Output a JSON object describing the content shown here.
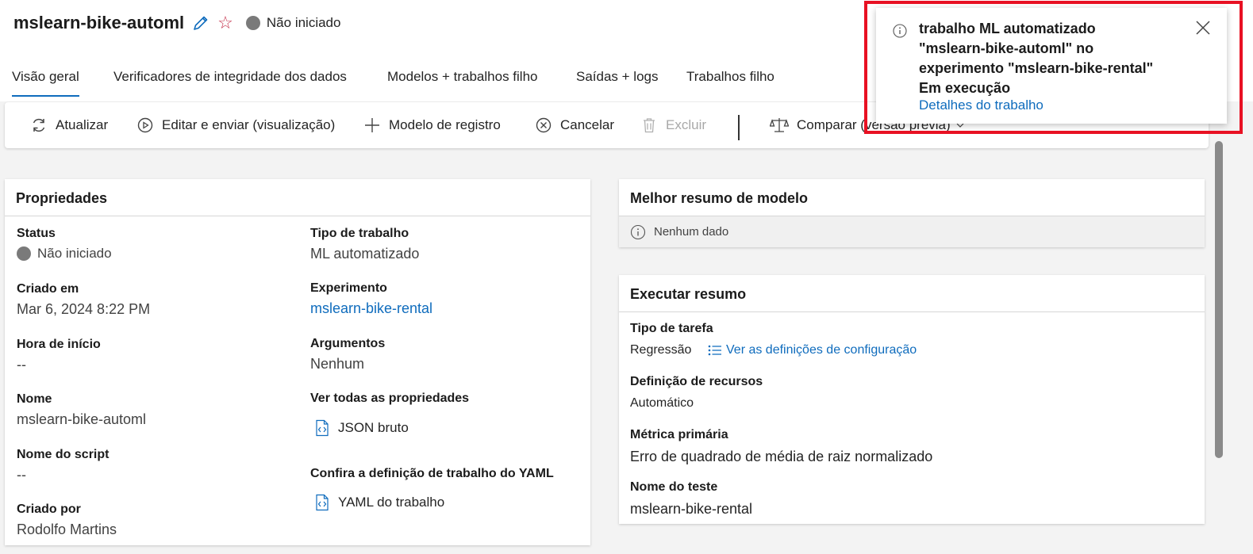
{
  "header": {
    "title": "mslearn-bike-automl",
    "status": "Não iniciado"
  },
  "tabs": [
    {
      "label": "Visão geral"
    },
    {
      "label": "Verificadores de integridade dos dados"
    },
    {
      "label": "Modelos + trabalhos filho"
    },
    {
      "label": "Saídas + logs"
    },
    {
      "label": "Trabalhos filho"
    }
  ],
  "toolbar": {
    "refresh": "Atualizar",
    "edit_submit": "Editar e enviar (visualização)",
    "register_model": "Modelo de registro",
    "cancel": "Cancelar",
    "delete": "Excluir",
    "compare": "Comparar (versão prévia)"
  },
  "properties": {
    "title": "Propriedades",
    "status_label": "Status",
    "status_value": "Não iniciado",
    "created_label": "Criado em",
    "created_value": "Mar 6, 2024 8:22 PM",
    "start_label": "Hora de início",
    "start_value": "--",
    "name_label": "Nome",
    "name_value": "mslearn-bike-automl",
    "script_label": "Nome do script",
    "script_value": "--",
    "created_by_label": "Criado por",
    "created_by_value": "Rodolfo Martins",
    "job_type_label": "Tipo de trabalho",
    "job_type_value": "ML automatizado",
    "experiment_label": "Experimento",
    "experiment_value": "mslearn-bike-rental",
    "arguments_label": "Argumentos",
    "arguments_value": "Nenhum",
    "all_props_label": "Ver todas as propriedades",
    "raw_json": "JSON bruto",
    "yaml_label": "Confira a definição de trabalho do YAML",
    "yaml_link": "YAML do trabalho"
  },
  "best_model": {
    "title": "Melhor resumo de modelo",
    "no_data": "Nenhum dado"
  },
  "run_summary": {
    "title": "Executar resumo",
    "task_type_label": "Tipo de tarefa",
    "task_type_value": "Regressão",
    "config_link": "Ver as definições de configuração",
    "resource_label": "Definição de recursos",
    "resource_value": "Automático",
    "metric_label": "Métrica primária",
    "metric_value": "Erro de quadrado de média de raiz normalizado",
    "test_label": "Nome do teste",
    "test_value": "mslearn-bike-rental"
  },
  "toast": {
    "line1": "trabalho ML automatizado",
    "line2": "\"mslearn-bike-automl\" no",
    "line3": "experimento \"mslearn-bike-rental\"",
    "line4": "Em execução",
    "link": "Detalhes do trabalho"
  },
  "colors": {
    "accent": "#0f6cbd",
    "star": "#c4314b",
    "status_grey": "#7a7a7a",
    "highlight_frame": "#e81123"
  }
}
